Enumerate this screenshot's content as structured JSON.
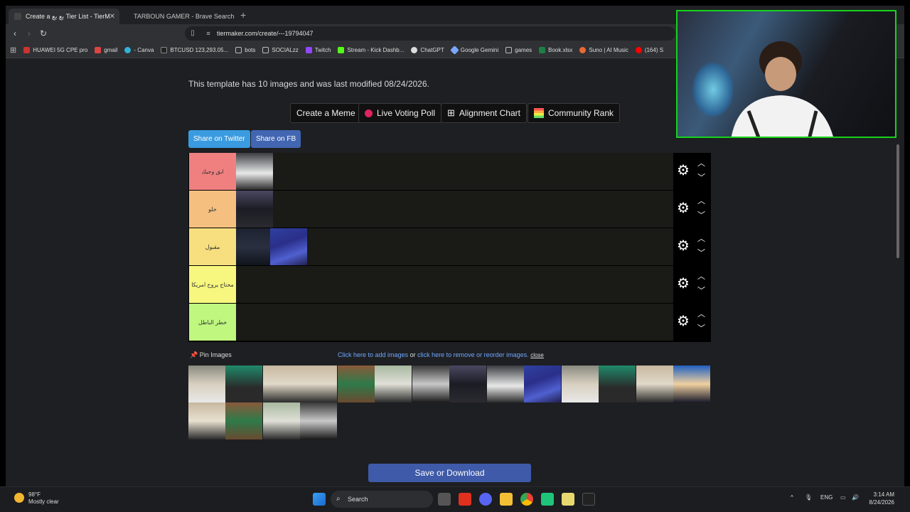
{
  "browser": {
    "tabs": [
      {
        "title": "Create a بع بع Tier List - TierMak",
        "active": true
      },
      {
        "title": "TARBOUN GAMER - Brave Search",
        "active": false
      }
    ],
    "new_tab": "+",
    "url": "tiermaker.com/create/---19794047",
    "bookmarks": [
      "HUAWEI 5G CPE pro",
      "gmail",
      "- Canva",
      "BTCUSD 123,293.05...",
      "bots",
      "SOCIALzz",
      "Twitch",
      "Stream - Kick Dashb...",
      "ChatGPT",
      "Google Gemini",
      "games",
      "Book.xlsx",
      "Suno | AI Music",
      "(164) S"
    ]
  },
  "page": {
    "info": "This template has 10 images and was last modified 08/24/2026.",
    "buttons": {
      "meme": "Create a Meme",
      "poll": "Live Voting Poll",
      "alignment": "Alignment Chart",
      "community": "Community Rank"
    },
    "share": {
      "twitter": "Share on Twitter",
      "fb": "Share on FB"
    },
    "tiers": [
      {
        "label": "ابق وجيك",
        "color": "#f08080"
      },
      {
        "label": "خلو",
        "color": "#f5bf80"
      },
      {
        "label": "مقبول",
        "color": "#f7df7f"
      },
      {
        "label": "محتاج يروح امريكا",
        "color": "#f7f77f"
      },
      {
        "label": "خطر الباطل",
        "color": "#bff77f"
      }
    ],
    "pin_label": "Pin Images",
    "add_images_link": "Click here to add images",
    "or_text": "or",
    "reorder_link": "click here to remove or reorder images.",
    "close_link": "close",
    "save": "Save or Download"
  },
  "taskbar": {
    "temp": "98°F",
    "weather": "Mostly clear",
    "search": "Search",
    "lang": "ENG",
    "time": "3:14 AM",
    "date": "8/24/2026"
  }
}
